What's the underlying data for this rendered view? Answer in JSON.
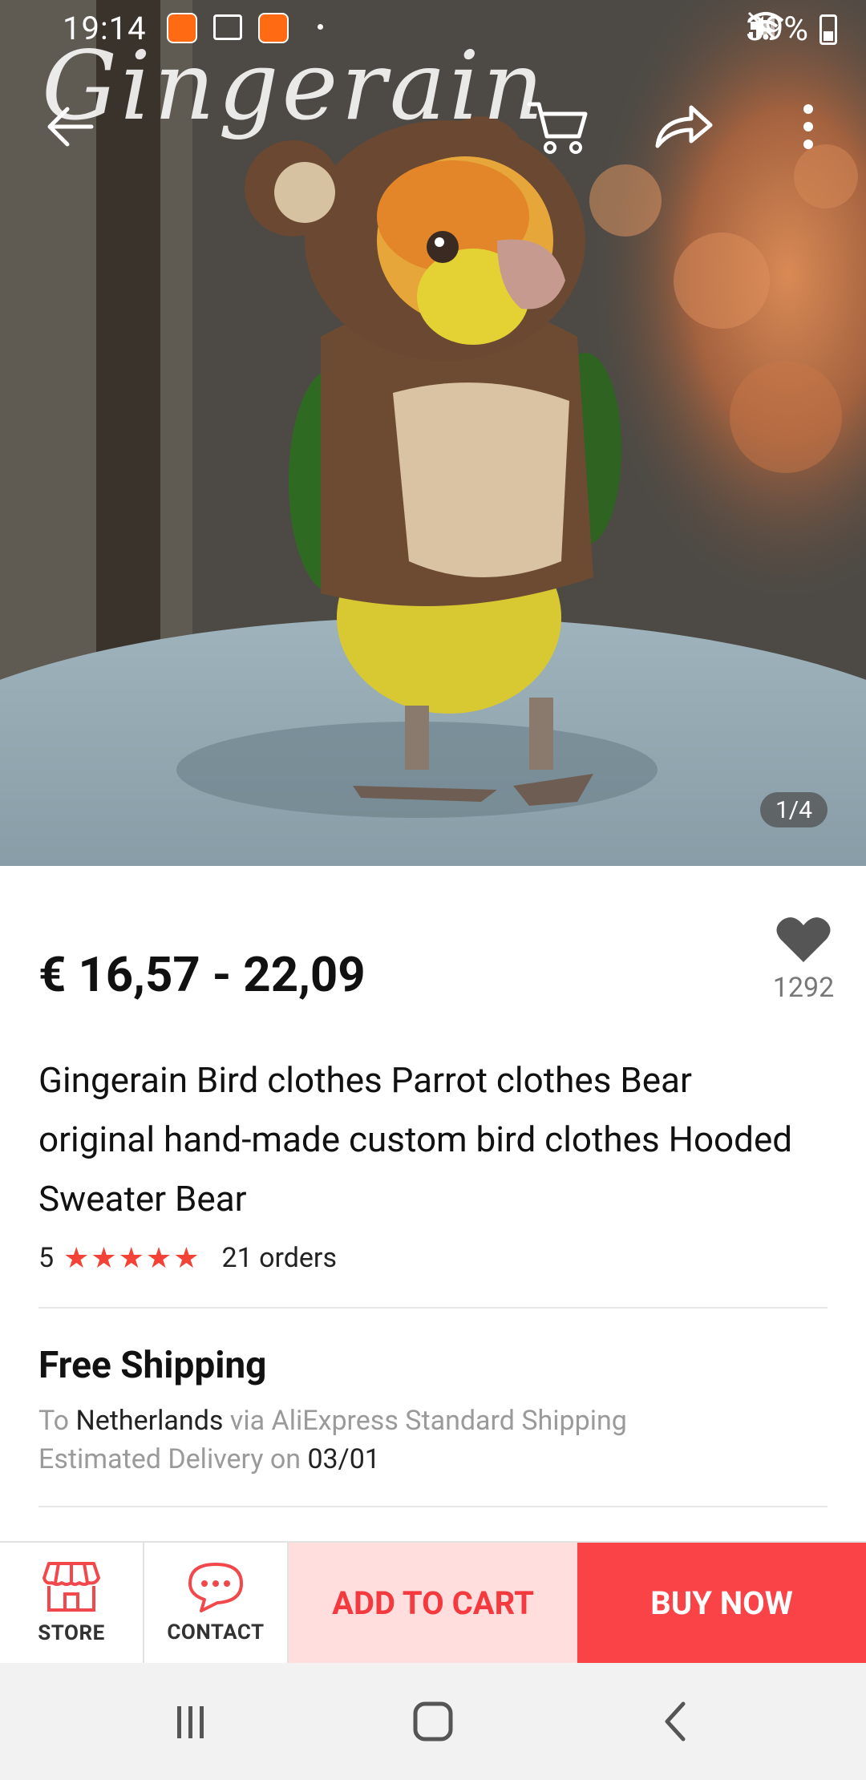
{
  "status_bar": {
    "time": "19:14",
    "battery": "39%"
  },
  "hero": {
    "watermark": "Gingerain",
    "image_counter": "1/4",
    "colors": {
      "overlay": "#00000040"
    }
  },
  "product": {
    "price": "€ 16,57 - 22,09",
    "wishlist_count": "1292",
    "title": "Gingerain Bird clothes Parrot clothes Bear original hand-made custom bird clothes Hooded Sweater Bear",
    "rating": "5",
    "stars": "★★★★★",
    "orders": "21 orders"
  },
  "shipping": {
    "title": "Free Shipping",
    "to_prefix": "To",
    "destination": "Netherlands",
    "via_text": "via AliExpress Standard Shipping",
    "delivery_prefix": "Estimated Delivery on",
    "delivery_date": "03/01"
  },
  "action_bar": {
    "store_label": "STORE",
    "contact_label": "CONTACT",
    "add_to_cart": "ADD TO CART",
    "buy_now": "BUY NOW"
  },
  "colors": {
    "accent": "#fa4346",
    "accent_light": "#ffdedd",
    "star": "#f44336"
  }
}
